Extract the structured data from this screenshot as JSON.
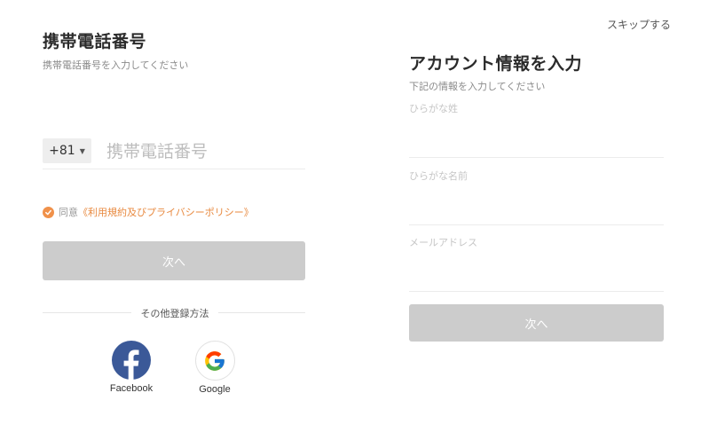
{
  "skip_label": "スキップする",
  "left": {
    "title": "携帯電話番号",
    "subtitle": "携帯電話番号を入力してください",
    "country_code": "+81",
    "phone_placeholder": "携帯電話番号",
    "agree_prefix": "同意",
    "agree_link": "《利用規約及びプライバシーポリシー》",
    "next_label": "次へ",
    "other_methods": "その他登録方法",
    "social": [
      {
        "name": "Facebook",
        "icon": "facebook-icon",
        "color": "#3b5998"
      },
      {
        "name": "Google",
        "icon": "google-icon"
      }
    ]
  },
  "right": {
    "title": "アカウント情報を入力",
    "subtitle": "下記の情報を入力してください",
    "fields": [
      {
        "label": "ひらがな姓",
        "value": ""
      },
      {
        "label": "ひらがな名前",
        "value": ""
      },
      {
        "label": "メールアドレス",
        "value": ""
      }
    ],
    "next_label": "次へ"
  },
  "colors": {
    "accent_orange": "#f0914a",
    "button_disabled": "#cccccc",
    "facebook_blue": "#3b5998"
  }
}
